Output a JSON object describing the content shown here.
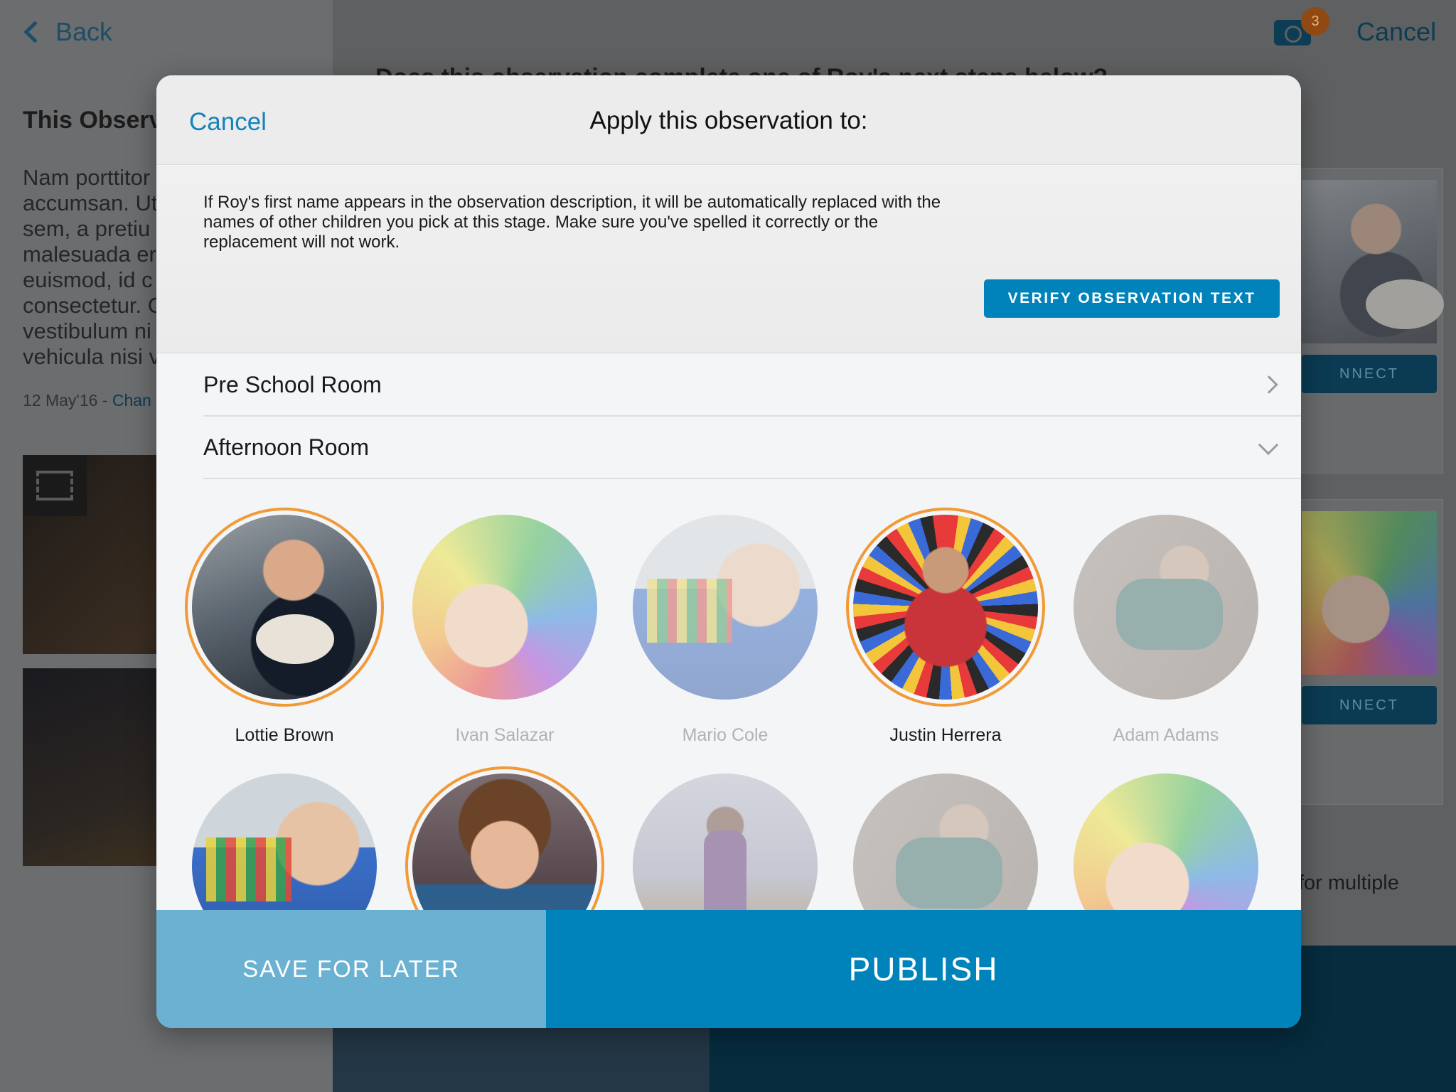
{
  "background": {
    "back_label": "Back",
    "section_title": "This Observ",
    "body_text": "Nam porttitor\naccumsan. Ut\nsem, a pretiu\nmalesuada er\neuismod, id c\nconsectetur. C\nvestibulum ni\nvehicula nisi v",
    "date": "12 May'16",
    "date_link": "- Chan",
    "heading": "Does this observation complete one of Roy's next steps below?",
    "camera_badge": "3",
    "cancel_label": "Cancel",
    "card_button_1": "NNECT",
    "card_button_2": "NNECT",
    "multi_text": "for multiple"
  },
  "modal": {
    "cancel_label": "Cancel",
    "title": "Apply this observation to:",
    "info_text": "If Roy's first name appears in the observation description, it will be automatically replaced with the names of other children you pick at this stage. Make sure you've spelled it correctly or the replacement will not work.",
    "verify_button": "VERIFY OBSERVATION TEXT",
    "rooms": [
      {
        "label": "Pre School Room",
        "state": "collapsed"
      },
      {
        "label": "Afternoon Room",
        "state": "expanded"
      }
    ],
    "children": [
      {
        "name": "Lottie Brown",
        "selected": true
      },
      {
        "name": "Ivan Salazar",
        "selected": false
      },
      {
        "name": "Mario Cole",
        "selected": false
      },
      {
        "name": "Justin Herrera",
        "selected": true
      },
      {
        "name": "Adam Adams",
        "selected": false
      },
      {
        "name": "",
        "selected": false
      },
      {
        "name": "",
        "selected": true
      },
      {
        "name": "",
        "selected": false
      },
      {
        "name": "",
        "selected": false
      },
      {
        "name": "",
        "selected": false
      }
    ],
    "save_button": "SAVE FOR LATER",
    "publish_button": "PUBLISH"
  },
  "colors": {
    "accent": "#0083ba",
    "save_button": "#6bb1d2",
    "selected_ring": "#f29a37"
  }
}
